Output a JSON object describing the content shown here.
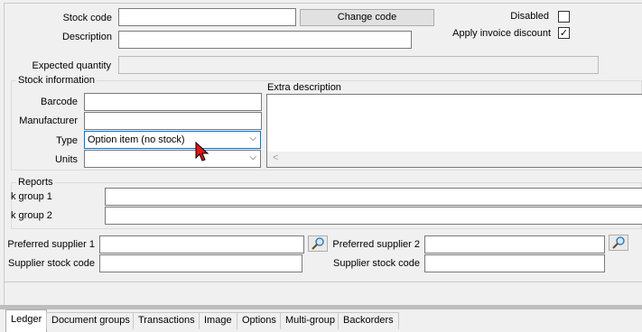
{
  "header": {
    "stock_code_label": "Stock code",
    "stock_code_value": "",
    "change_code_button": "Change code",
    "description_label": "Description",
    "description_value": "",
    "disabled_label": "Disabled",
    "disabled_checked": false,
    "apply_invoice_discount_label": "Apply invoice discount",
    "apply_invoice_discount_checked": true,
    "expected_quantity_label": "Expected quantity",
    "expected_quantity_value": ""
  },
  "stock_information": {
    "title": "Stock information",
    "barcode_label": "Barcode",
    "barcode_value": "",
    "manufacturer_label": "Manufacturer",
    "manufacturer_value": "",
    "type_label": "Type",
    "type_value": "Option item (no stock)",
    "units_label": "Units",
    "units_value": "",
    "extra_description_label": "Extra description",
    "extra_description_value": ""
  },
  "reports": {
    "title": "Reports",
    "group1_label": "k group 1",
    "group2_label": "k group 2"
  },
  "suppliers": {
    "preferred1_label": "Preferred supplier 1",
    "preferred2_label": "Preferred supplier 2",
    "stock_code1_label": "Supplier stock code",
    "stock_code2_label": "Supplier stock code"
  },
  "tabs": [
    {
      "label": "Ledger",
      "active": true
    },
    {
      "label": "Document groups"
    },
    {
      "label": "Transactions"
    },
    {
      "label": "Image"
    },
    {
      "label": "Options"
    },
    {
      "label": "Multi-group"
    },
    {
      "label": "Backorders"
    }
  ],
  "icons": {
    "checkmark": "✓",
    "dropdown": "⌵",
    "scroll_left": "<"
  },
  "colors": {
    "background": "#f0f0f0",
    "field_border": "#7a7a7a",
    "focus_border": "#0078d7",
    "selected_bg": "#cce8ff"
  }
}
